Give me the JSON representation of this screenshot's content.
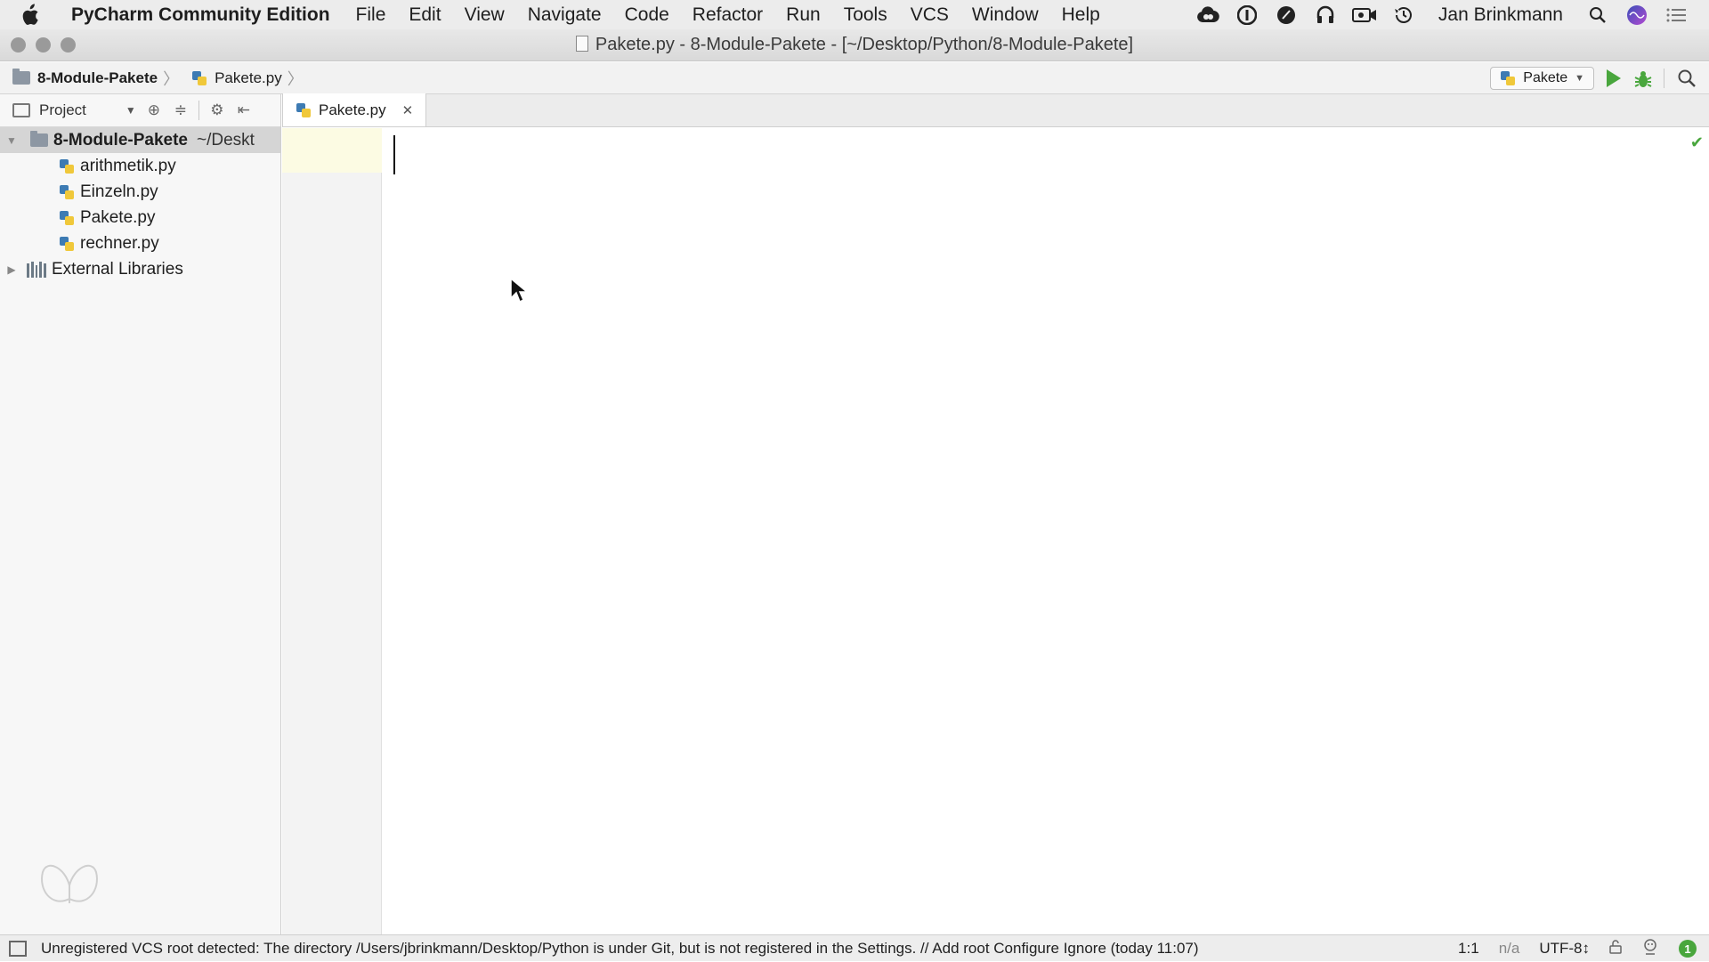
{
  "menubar": {
    "app_name": "PyCharm Community Edition",
    "items": [
      "File",
      "Edit",
      "View",
      "Navigate",
      "Code",
      "Refactor",
      "Run",
      "Tools",
      "VCS",
      "Window",
      "Help"
    ],
    "user": "Jan Brinkmann",
    "status_icons": [
      "creative-cloud-icon",
      "password-manager-icon",
      "notes-icon",
      "headphones-icon",
      "screen-recorder-icon",
      "time-machine-icon"
    ]
  },
  "window": {
    "title": "Pakete.py - 8-Module-Pakete - [~/Desktop/Python/8-Module-Pakete]"
  },
  "navbar": {
    "crumb_project": "8-Module-Pakete",
    "crumb_file": "Pakete.py",
    "run_config": "Pakete"
  },
  "project_panel": {
    "view_label": "Project",
    "root_name": "8-Module-Pakete",
    "root_path": "~/Deskt",
    "files": [
      "arithmetik.py",
      "Einzeln.py",
      "Pakete.py",
      "rechner.py"
    ],
    "external": "External Libraries"
  },
  "editor": {
    "tab_label": "Pakete.py"
  },
  "statusbar": {
    "message": "Unregistered VCS root detected: The directory /Users/jbrinkmann/Desktop/Python is under Git, but is not registered in the Settings. // Add root  Configure  Ignore (today 11:07)",
    "position": "1:1",
    "na": "n/a",
    "encoding": "UTF-8↕",
    "notifications": "1"
  },
  "colors": {
    "run_green": "#49a63d",
    "python_blue": "#3d7bb3",
    "python_yellow": "#f0c83a",
    "caret_line": "#fcfbe3"
  }
}
